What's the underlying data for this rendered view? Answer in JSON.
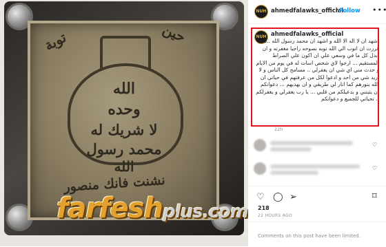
{
  "post": {
    "author": "ahmedfalawks_official",
    "follow_label": "Follow",
    "separator": "•",
    "more_label": "•••",
    "avatar_text": "NUH",
    "caption": "اشهد ان لا اله الا الله و اشهد ان محمد رسول الله ..لقد قررت ان اتوب الي الله توبه نصوحه راجيا مغفرته و ان ابدل كل ما في وسعي علي ان اكون علي الصراط المستقيم ... ارجوا لاي شخص اسات له في يوم من الايام و حدث مني اي شي ان يغفرلي .. مسامح كل الناس و لا اريد شي من احد و ادعوا لكل من عرفتهم في حياتي ان الله ينورهم كما انار لي طريقي و ان يهديهم ... دعواتكم ان يثبتني و بدعيلكم من قلبي ... يا رب يغفرلي و يغفرلكم .. تحياتي للجميع و دعواتكم",
    "time": "22h",
    "likes": "218",
    "ago": "22 HOURS AGO",
    "comments_limited": "Comments on this post have been limited."
  },
  "photo": {
    "engraving": [
      "توبة",
      "حين",
      "الله",
      "وحده",
      "لا شريك له",
      "محمد رسول",
      "الله",
      "نشنت فانك منصور"
    ],
    "watermark_main": "farfesh",
    "watermark_plus": "plus.com"
  },
  "icons": {
    "like": "heart-icon",
    "comment": "comment-icon",
    "share": "send-icon",
    "save": "bookmark-icon"
  },
  "colors": {
    "follow": "#0095f6",
    "highlight_box": "#e0141e",
    "watermark": "#e3a230"
  }
}
